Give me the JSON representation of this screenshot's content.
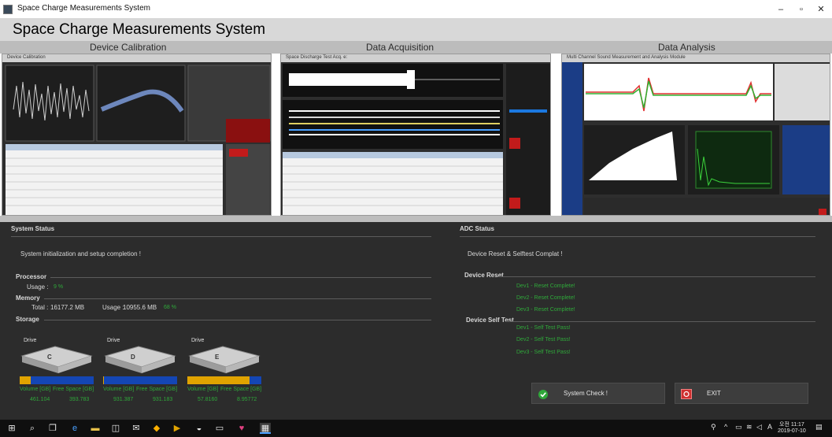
{
  "window": {
    "title": "Space Charge Measurements System",
    "controls": {
      "minimize": "–",
      "maximize": "▫",
      "close": "✕"
    }
  },
  "header": {
    "title": "Space Charge Measurements System"
  },
  "tabs": [
    {
      "label": "Device Calibration"
    },
    {
      "label": "Data Acquisition"
    },
    {
      "label": "Data Analysis"
    }
  ],
  "previews": {
    "calibration": {
      "caption": "Device Calibration"
    },
    "acquisition": {
      "caption": "Space Discharge Test Acq. e:"
    },
    "analysis": {
      "caption": "Multi Channel Sound Measurement and Analysis Module"
    }
  },
  "system_status": {
    "heading": "System Status",
    "message": "System initialization and setup completion !",
    "processor": {
      "heading": "Processor",
      "usage_label": "Usage :",
      "usage_value": "9 %"
    },
    "memory": {
      "heading": "Memory",
      "total_label": "Total :",
      "total_value": "16177.2 MB",
      "usage_label": "Usage :",
      "usage_value": "10955.6 MB",
      "usage_percent": "68 %"
    },
    "storage": {
      "heading": "Storage",
      "drive_label": "Drive",
      "volume_label": "Volume [GB]",
      "free_label": "Free Space [GB]",
      "drives": [
        {
          "letter": "C",
          "volume": "461.104",
          "free": "393.783",
          "used_fraction": 0.146
        },
        {
          "letter": "D",
          "volume": "931.387",
          "free": "931.183",
          "used_fraction": 0.01
        },
        {
          "letter": "E",
          "volume": "57.8160",
          "free": "8.95772",
          "used_fraction": 0.845
        }
      ]
    }
  },
  "adc_status": {
    "heading": "ADC Status",
    "message": "Device Reset & Selftest Complat !",
    "device_reset": {
      "heading": "Device Reset",
      "items": [
        "Dev1 - Reset Complete!",
        "Dev2 - Reset Complete!",
        "Dev3 - Reset Complete!"
      ]
    },
    "device_self_test": {
      "heading": "Device Self Test",
      "items": [
        "Dev1 - Self Test Pass!",
        "Dev2 - Self Test Pass!",
        "Dev3 - Self Test Pass!"
      ]
    }
  },
  "buttons": {
    "system_check": "System Check !",
    "exit": "EXIT"
  },
  "taskbar": {
    "tray_lang": "A",
    "time": "오전 11:17",
    "date": "2019-07-10"
  },
  "colors": {
    "status_green": "#2fa83a",
    "panel_bg": "#2c2c2c",
    "drive_blue": "#1446b4",
    "drive_used": "#e0a300",
    "exit_red": "#d03030"
  }
}
